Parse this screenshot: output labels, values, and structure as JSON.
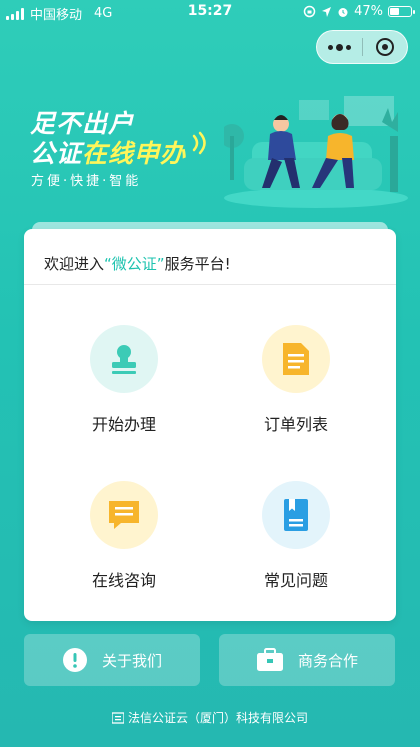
{
  "status_bar": {
    "carrier": "中国移动",
    "network": "4G",
    "time": "15:27",
    "battery": "47%",
    "battery_level": 0.47
  },
  "hero": {
    "line1": "足不出户",
    "line2_a": "公证",
    "line2_b": "在线申办",
    "tagline": "方便·快捷·智能"
  },
  "card": {
    "welcome_prefix": "欢迎进入",
    "welcome_highlight": "“微公证”",
    "welcome_suffix": "服务平台!",
    "tiles": [
      {
        "label": "开始办理",
        "icon": "stamp-icon"
      },
      {
        "label": "订单列表",
        "icon": "document-icon"
      },
      {
        "label": "在线咨询",
        "icon": "chat-icon"
      },
      {
        "label": "常见问题",
        "icon": "book-icon"
      }
    ]
  },
  "actions": {
    "about": "关于我们",
    "business": "商务合作"
  },
  "footer": {
    "company": "法信公证云（厦门）科技有限公司"
  },
  "colors": {
    "accent": "#23c2b4",
    "highlight": "#fff65a",
    "icon_yellow": "#f7b52c",
    "icon_blue": "#2a9ee3"
  }
}
